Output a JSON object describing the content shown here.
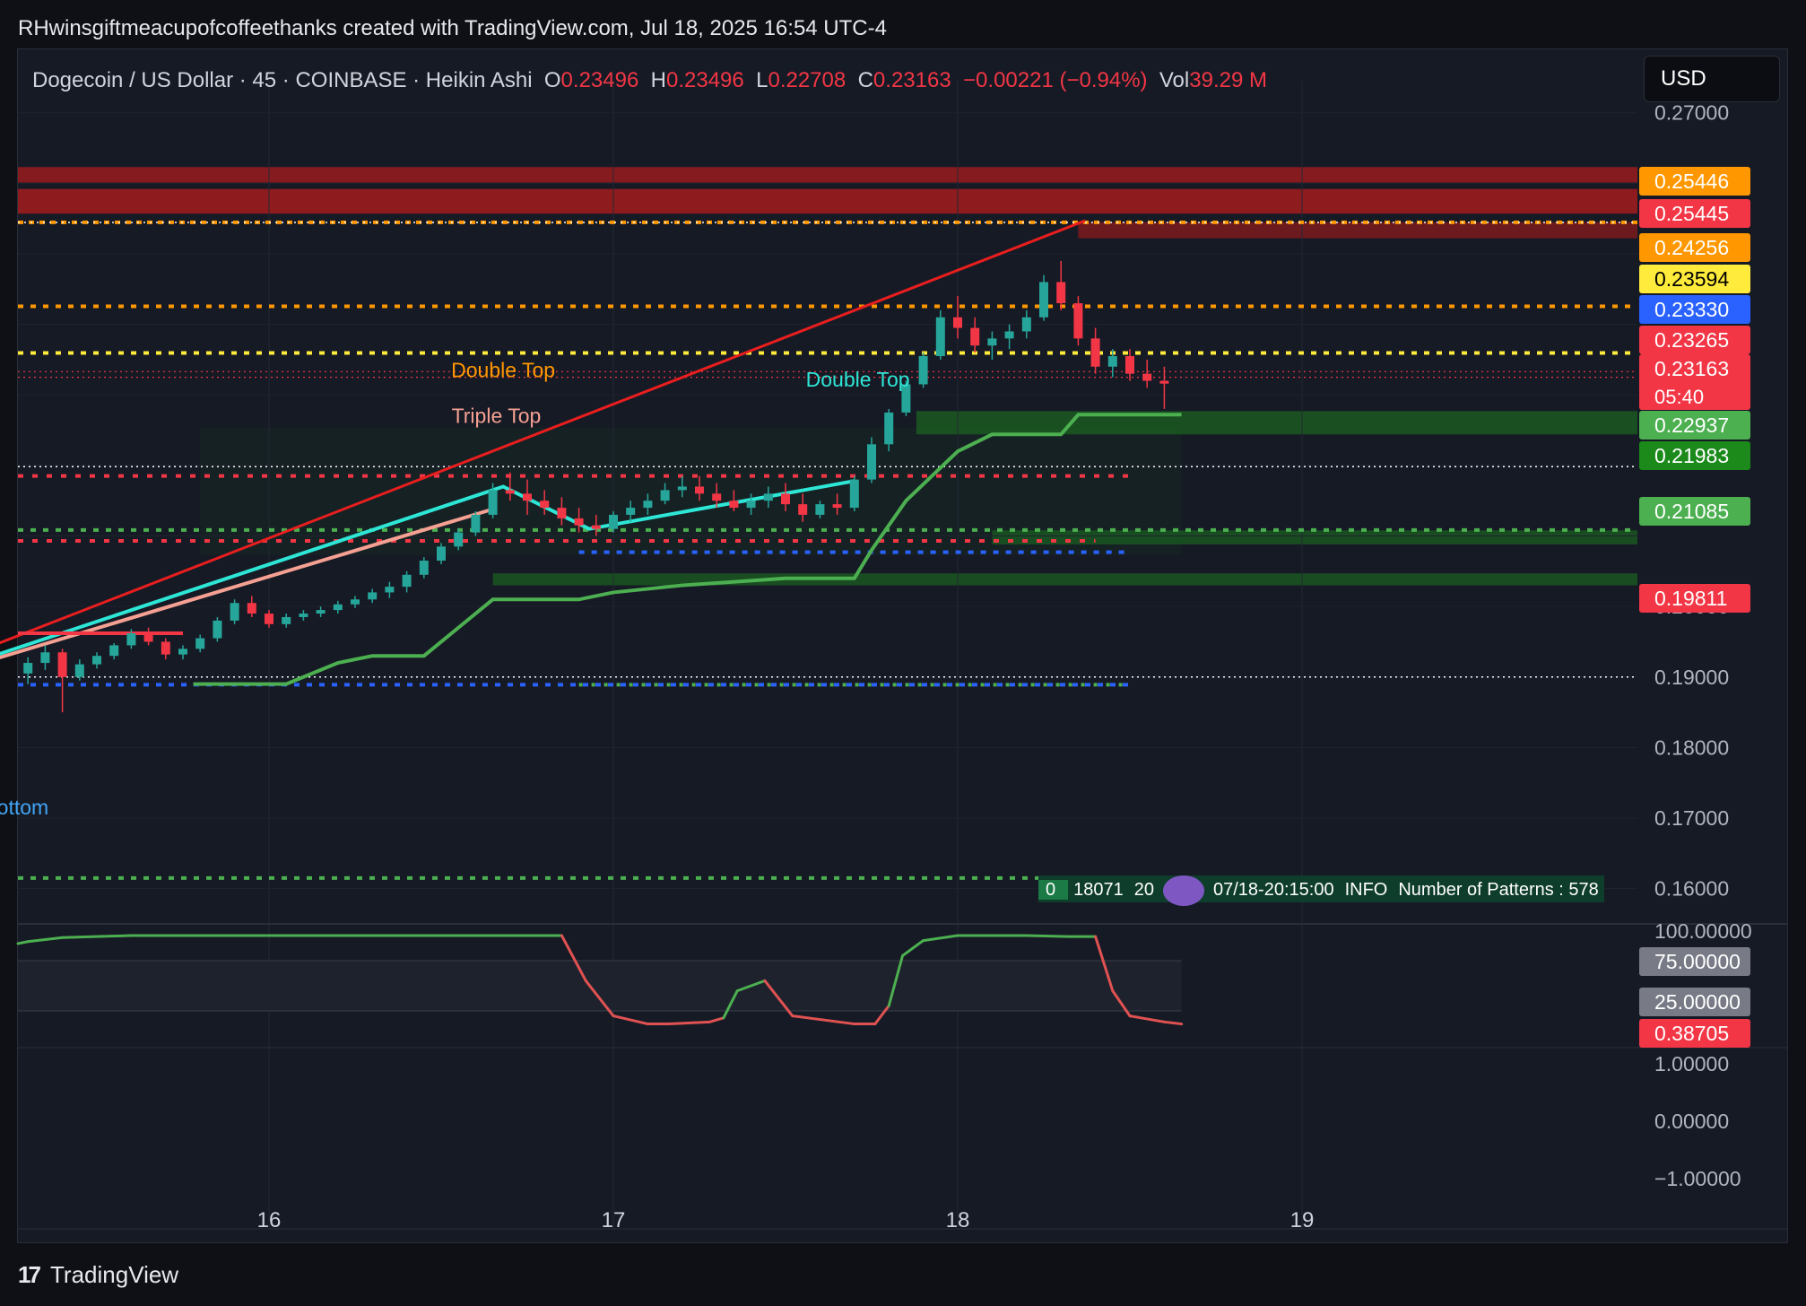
{
  "header": {
    "attribution": "RHwinsgiftmeacupofcoffeethanks created with TradingView.com, Jul 18, 2025 16:54 UTC-4"
  },
  "legend": {
    "symbol": "Dogecoin / US Dollar · 45 · COINBASE · Heikin Ashi",
    "o_label": "O",
    "o_value": "0.23496",
    "h_label": "H",
    "h_value": "0.23496",
    "l_label": "L",
    "l_value": "0.22708",
    "c_label": "C",
    "c_value": "0.23163",
    "change": "−0.00221 (−0.94%)",
    "vol_label": "Vol",
    "vol_value": "39.29 M"
  },
  "currency_button": "USD",
  "info_bar": {
    "cell0": "0",
    "cell1": "18071",
    "cell2": "20",
    "cell3": "07/18-20:15:00",
    "cell4": "INFO",
    "cell5": "Number of Patterns : 578"
  },
  "footer": {
    "brand": "TradingView"
  },
  "colors": {
    "bg": "#161a25",
    "up": "#26a69a",
    "down": "#f23645",
    "cyan": "#2ee6d6",
    "salmon": "#f4a092",
    "green": "#4caf50",
    "orange": "#ff9800",
    "yellow": "#ffeb3b",
    "blue": "#2962ff",
    "red_zone": "#b71c1c",
    "green_zone": "#1b5e20"
  },
  "chart_data": [
    {
      "type": "candlestick",
      "candle_style": "Heikin Ashi",
      "x_ticks": [
        "16",
        "17",
        "18",
        "19"
      ],
      "ylim": [
        0.155,
        0.272
      ],
      "y_ticks": [
        "0.27000",
        "0.20000",
        "0.19000",
        "0.18000",
        "0.17000",
        "0.16000"
      ],
      "price_labels": [
        {
          "text": "0.25446",
          "value": 0.25446,
          "color": "#ff9800"
        },
        {
          "text": "0.25445",
          "value": 0.25445,
          "color": "#f23645"
        },
        {
          "text": "0.24256",
          "value": 0.24256,
          "color": "#ff9800"
        },
        {
          "text": "0.23594",
          "value": 0.23594,
          "color": "#ffeb3b"
        },
        {
          "text": "0.23330",
          "value": 0.2333,
          "color": "#2962ff"
        },
        {
          "text": "0.23265",
          "value": 0.23265,
          "color": "#f23645"
        },
        {
          "text": "0.23163",
          "value": 0.23163,
          "color": "#f23645",
          "sub": "05:40"
        },
        {
          "text": "0.22937",
          "value": 0.22937,
          "color": "#4caf50"
        },
        {
          "text": "0.21983",
          "value": 0.21983,
          "color": "#1b8a1b"
        },
        {
          "text": "0.21085",
          "value": 0.21085,
          "color": "#4caf50"
        },
        {
          "text": "0.19811",
          "value": 0.19811,
          "color": "#f23645"
        }
      ],
      "annotations": [
        {
          "text": "Double Top",
          "x": 16.68,
          "y": 0.2325,
          "color": "#ff9800"
        },
        {
          "text": "Triple Top",
          "x": 16.66,
          "y": 0.226,
          "color": "#f4a092"
        },
        {
          "text": "Double Top",
          "x": 17.71,
          "y": 0.2312,
          "color": "#2ee6d6"
        },
        {
          "text": "uble Bottom",
          "x": 15.2,
          "y": 0.1705,
          "color": "#42a5f5"
        }
      ],
      "candles": [
        [
          15.3,
          0.1905,
          0.1928,
          0.189,
          0.192
        ],
        [
          15.35,
          0.192,
          0.1945,
          0.191,
          0.1935
        ],
        [
          15.4,
          0.1935,
          0.194,
          0.185,
          0.19
        ],
        [
          15.45,
          0.19,
          0.1925,
          0.1895,
          0.1918
        ],
        [
          15.5,
          0.1918,
          0.1935,
          0.1912,
          0.193
        ],
        [
          15.55,
          0.193,
          0.1948,
          0.1925,
          0.1945
        ],
        [
          15.6,
          0.1945,
          0.1968,
          0.194,
          0.1962
        ],
        [
          15.65,
          0.1962,
          0.197,
          0.1945,
          0.195
        ],
        [
          15.7,
          0.195,
          0.1955,
          0.1925,
          0.1932
        ],
        [
          15.75,
          0.1932,
          0.1945,
          0.1925,
          0.194
        ],
        [
          15.8,
          0.194,
          0.196,
          0.1935,
          0.1955
        ],
        [
          15.85,
          0.1955,
          0.1985,
          0.195,
          0.198
        ],
        [
          15.9,
          0.198,
          0.201,
          0.1975,
          0.2005
        ],
        [
          15.95,
          0.2005,
          0.2015,
          0.1985,
          0.199
        ],
        [
          16.0,
          0.199,
          0.1995,
          0.197,
          0.1975
        ],
        [
          16.05,
          0.1975,
          0.199,
          0.197,
          0.1985
        ],
        [
          16.1,
          0.1985,
          0.1995,
          0.198,
          0.199
        ],
        [
          16.15,
          0.199,
          0.2,
          0.1985,
          0.1995
        ],
        [
          16.2,
          0.1995,
          0.2008,
          0.199,
          0.2003
        ],
        [
          16.25,
          0.2003,
          0.2015,
          0.1998,
          0.201
        ],
        [
          16.3,
          0.201,
          0.2025,
          0.2005,
          0.202
        ],
        [
          16.35,
          0.202,
          0.2035,
          0.2012,
          0.2028
        ],
        [
          16.4,
          0.2028,
          0.205,
          0.202,
          0.2045
        ],
        [
          16.45,
          0.2045,
          0.207,
          0.204,
          0.2065
        ],
        [
          16.5,
          0.2065,
          0.209,
          0.206,
          0.2085
        ],
        [
          16.55,
          0.2085,
          0.211,
          0.208,
          0.2105
        ],
        [
          16.6,
          0.2105,
          0.2135,
          0.21,
          0.213
        ],
        [
          16.65,
          0.213,
          0.2175,
          0.2125,
          0.2165
        ],
        [
          16.7,
          0.2165,
          0.219,
          0.215,
          0.216
        ],
        [
          16.75,
          0.216,
          0.218,
          0.213,
          0.215
        ],
        [
          16.8,
          0.215,
          0.2165,
          0.213,
          0.214
        ],
        [
          16.85,
          0.214,
          0.2155,
          0.2115,
          0.2125
        ],
        [
          16.9,
          0.2125,
          0.214,
          0.2105,
          0.2115
        ],
        [
          16.95,
          0.2115,
          0.213,
          0.21,
          0.211
        ],
        [
          17.0,
          0.211,
          0.2135,
          0.2105,
          0.213
        ],
        [
          17.05,
          0.213,
          0.215,
          0.212,
          0.214
        ],
        [
          17.1,
          0.214,
          0.216,
          0.213,
          0.215
        ],
        [
          17.15,
          0.215,
          0.2175,
          0.2145,
          0.2165
        ],
        [
          17.2,
          0.2165,
          0.2185,
          0.2155,
          0.217
        ],
        [
          17.25,
          0.217,
          0.2185,
          0.215,
          0.216
        ],
        [
          17.3,
          0.216,
          0.2175,
          0.214,
          0.215
        ],
        [
          17.35,
          0.215,
          0.2165,
          0.2135,
          0.214
        ],
        [
          17.4,
          0.214,
          0.216,
          0.213,
          0.215
        ],
        [
          17.45,
          0.215,
          0.217,
          0.214,
          0.216
        ],
        [
          17.5,
          0.216,
          0.2175,
          0.2135,
          0.2145
        ],
        [
          17.55,
          0.2145,
          0.216,
          0.212,
          0.213
        ],
        [
          17.6,
          0.213,
          0.215,
          0.2125,
          0.2145
        ],
        [
          17.65,
          0.2145,
          0.216,
          0.213,
          0.214
        ],
        [
          17.7,
          0.214,
          0.2185,
          0.2135,
          0.218
        ],
        [
          17.75,
          0.218,
          0.224,
          0.2175,
          0.223
        ],
        [
          17.8,
          0.223,
          0.228,
          0.222,
          0.2275
        ],
        [
          17.85,
          0.2275,
          0.232,
          0.227,
          0.2315
        ],
        [
          17.9,
          0.2315,
          0.236,
          0.231,
          0.2355
        ],
        [
          17.95,
          0.2355,
          0.242,
          0.235,
          0.241
        ],
        [
          18.0,
          0.241,
          0.244,
          0.238,
          0.2395
        ],
        [
          18.05,
          0.2395,
          0.241,
          0.236,
          0.237
        ],
        [
          18.1,
          0.237,
          0.239,
          0.235,
          0.238
        ],
        [
          18.15,
          0.238,
          0.24,
          0.2365,
          0.239
        ],
        [
          18.2,
          0.239,
          0.242,
          0.238,
          0.241
        ],
        [
          18.25,
          0.241,
          0.247,
          0.2405,
          0.246
        ],
        [
          18.3,
          0.246,
          0.249,
          0.242,
          0.243
        ],
        [
          18.35,
          0.243,
          0.244,
          0.237,
          0.238
        ],
        [
          18.4,
          0.238,
          0.2395,
          0.233,
          0.234
        ],
        [
          18.45,
          0.234,
          0.2365,
          0.2325,
          0.2355
        ],
        [
          18.5,
          0.2355,
          0.2365,
          0.232,
          0.233
        ],
        [
          18.55,
          0.233,
          0.235,
          0.231,
          0.232
        ],
        [
          18.6,
          0.232,
          0.234,
          0.228,
          0.2316
        ]
      ]
    },
    {
      "type": "line",
      "title": "",
      "ylim": [
        -1.3,
        101
      ],
      "y_ticks": [
        "100.00000",
        "1.00000",
        "0.00000",
        "−1.00000"
      ],
      "level_labels": [
        {
          "text": "75.00000",
          "value": 75,
          "color": "#787b86"
        },
        {
          "text": "25.00000",
          "value": 25,
          "color": "#787b86"
        },
        {
          "text": "0.38705",
          "value": 0.38705,
          "color": "#f23645"
        }
      ],
      "x": [
        15.27,
        15.3,
        15.4,
        15.6,
        16.2,
        16.7,
        16.85,
        16.92,
        17.0,
        17.1,
        17.16,
        17.28,
        17.32,
        17.36,
        17.44,
        17.52,
        17.7,
        17.76,
        17.8,
        17.84,
        17.9,
        18.0,
        18.2,
        18.32,
        18.4,
        18.45,
        18.5,
        18.6,
        18.65
      ],
      "values": [
        92,
        94,
        98,
        100,
        100,
        100,
        100,
        55,
        20,
        12,
        12,
        14,
        18,
        45,
        55,
        20,
        12,
        12,
        30,
        80,
        95,
        100,
        100,
        99,
        99,
        45,
        20,
        14,
        12
      ]
    }
  ]
}
